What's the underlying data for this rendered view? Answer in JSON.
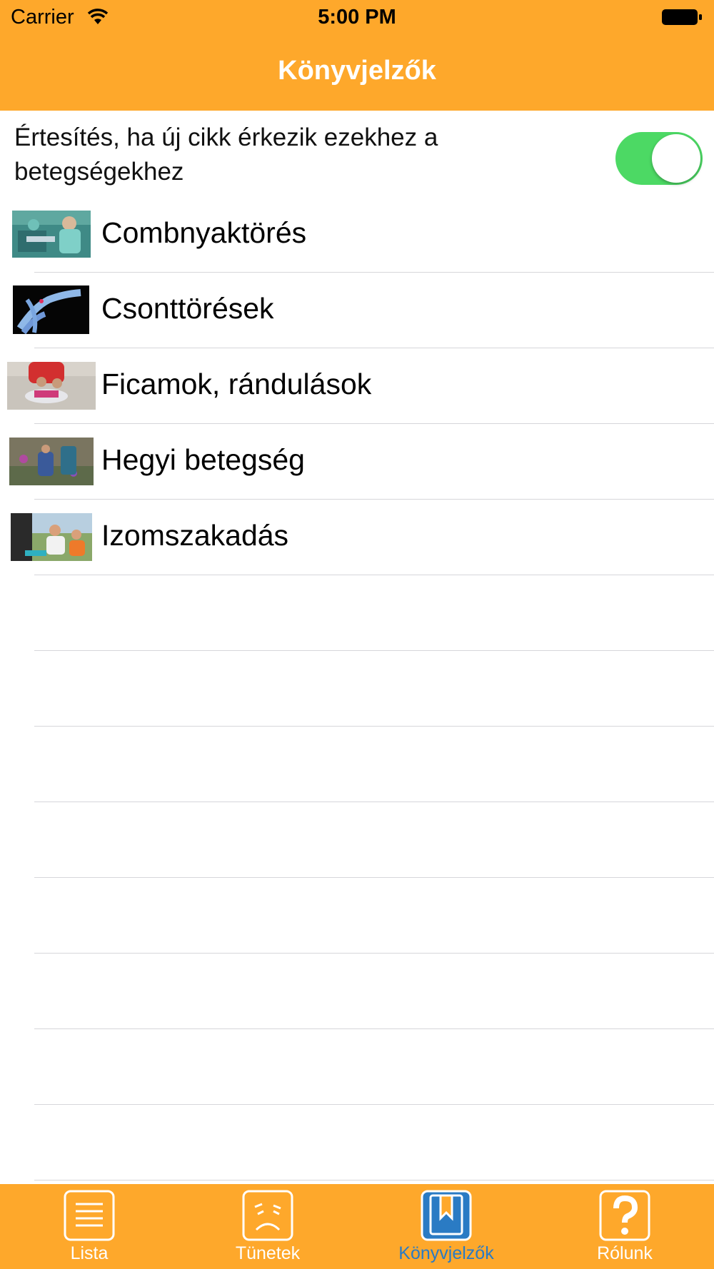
{
  "status_bar": {
    "carrier": "Carrier",
    "time": "5:00 PM"
  },
  "nav": {
    "title": "Könyvjelzők"
  },
  "notification": {
    "label": "Értesítés, ha új cikk érkezik ezekhez a betegségekhez",
    "enabled": true
  },
  "bookmarks": [
    {
      "title": "Combnyaktörés",
      "thumb": "surgery-photo"
    },
    {
      "title": "Csonttörések",
      "thumb": "xray-photo"
    },
    {
      "title": "Ficamok, rándulások",
      "thumb": "ankle-photo"
    },
    {
      "title": "Hegyi betegség",
      "thumb": "hiker-photo"
    },
    {
      "title": "Izomszakadás",
      "thumb": "runner-photo"
    }
  ],
  "tabs": [
    {
      "label": "Lista",
      "icon": "list-icon"
    },
    {
      "label": "Tünetek",
      "icon": "sad-face-icon"
    },
    {
      "label": "Könyvjelzők",
      "icon": "bookmark-icon",
      "active": true
    },
    {
      "label": "Rólunk",
      "icon": "question-icon"
    }
  ],
  "colors": {
    "accent": "#fea82b",
    "toggle_on": "#4cd964",
    "active_tab": "#2a7bc4"
  }
}
